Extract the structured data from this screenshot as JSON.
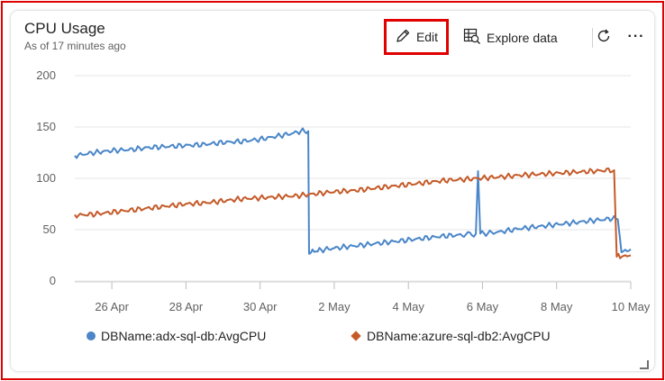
{
  "card": {
    "title": "CPU Usage",
    "subtitle": "As of 17 minutes ago"
  },
  "toolbar": {
    "edit_label": "Edit",
    "explore_label": "Explore data",
    "more_label": "···"
  },
  "colors": {
    "series1": "#4a86c8",
    "series2": "#c55a28",
    "highlight_border": "#e00000",
    "grid": "#e6e6e6"
  },
  "chart_data": {
    "type": "line",
    "x_ticks": [
      "26 Apr",
      "28 Apr",
      "30 Apr",
      "2 May",
      "4 May",
      "6 May",
      "8 May",
      "10 May"
    ],
    "x_tick_days": [
      1,
      3,
      5,
      7,
      9,
      11,
      13,
      15
    ],
    "x_range_days": [
      0,
      15
    ],
    "y_ticks": [
      "0",
      "50",
      "100",
      "150",
      "200"
    ],
    "ylim": [
      0,
      200
    ],
    "grid": true,
    "legend_position": "bottom",
    "series": [
      {
        "name": "DBName:adx-sql-db:AvgCPU",
        "points": [
          [
            0.0,
            122
          ],
          [
            0.5,
            125
          ],
          [
            1.0,
            127
          ],
          [
            1.5,
            128
          ],
          [
            2.0,
            130
          ],
          [
            2.5,
            131
          ],
          [
            3.0,
            132
          ],
          [
            3.5,
            133
          ],
          [
            4.0,
            135
          ],
          [
            4.5,
            136
          ],
          [
            5.0,
            138
          ],
          [
            5.3,
            140
          ],
          [
            5.6,
            142
          ],
          [
            5.9,
            144
          ],
          [
            6.1,
            146
          ],
          [
            6.3,
            146
          ],
          [
            6.32,
            28
          ],
          [
            6.6,
            30
          ],
          [
            7.0,
            32
          ],
          [
            7.5,
            34
          ],
          [
            8.0,
            36
          ],
          [
            8.5,
            38
          ],
          [
            9.0,
            40
          ],
          [
            9.5,
            42
          ],
          [
            10.0,
            44
          ],
          [
            10.5,
            45
          ],
          [
            10.82,
            46
          ],
          [
            10.88,
            107
          ],
          [
            10.94,
            46
          ],
          [
            11.5,
            48
          ],
          [
            12.0,
            51
          ],
          [
            12.5,
            53
          ],
          [
            13.0,
            55
          ],
          [
            13.5,
            57
          ],
          [
            14.0,
            59
          ],
          [
            14.3,
            60
          ],
          [
            14.5,
            61
          ],
          [
            14.65,
            60
          ],
          [
            14.75,
            28
          ],
          [
            14.85,
            30
          ],
          [
            15.0,
            31
          ]
        ]
      },
      {
        "name": "DBName:azure-sql-db2:AvgCPU",
        "points": [
          [
            0.0,
            64
          ],
          [
            0.5,
            65
          ],
          [
            1.0,
            67
          ],
          [
            1.5,
            69
          ],
          [
            2.0,
            71
          ],
          [
            2.5,
            73
          ],
          [
            3.0,
            75
          ],
          [
            3.5,
            76
          ],
          [
            4.0,
            78
          ],
          [
            4.5,
            80
          ],
          [
            5.0,
            81
          ],
          [
            5.5,
            82
          ],
          [
            6.0,
            83
          ],
          [
            6.5,
            85
          ],
          [
            7.0,
            87
          ],
          [
            7.5,
            88
          ],
          [
            8.0,
            90
          ],
          [
            8.5,
            92
          ],
          [
            9.0,
            94
          ],
          [
            9.5,
            96
          ],
          [
            10.0,
            98
          ],
          [
            10.5,
            99
          ],
          [
            10.9,
            100
          ],
          [
            11.3,
            101
          ],
          [
            11.7,
            102
          ],
          [
            12.0,
            103
          ],
          [
            12.5,
            104
          ],
          [
            13.0,
            105
          ],
          [
            13.5,
            106
          ],
          [
            14.0,
            107
          ],
          [
            14.4,
            108
          ],
          [
            14.55,
            108
          ],
          [
            14.62,
            24
          ],
          [
            14.9,
            24
          ],
          [
            15.0,
            25
          ]
        ]
      }
    ]
  }
}
